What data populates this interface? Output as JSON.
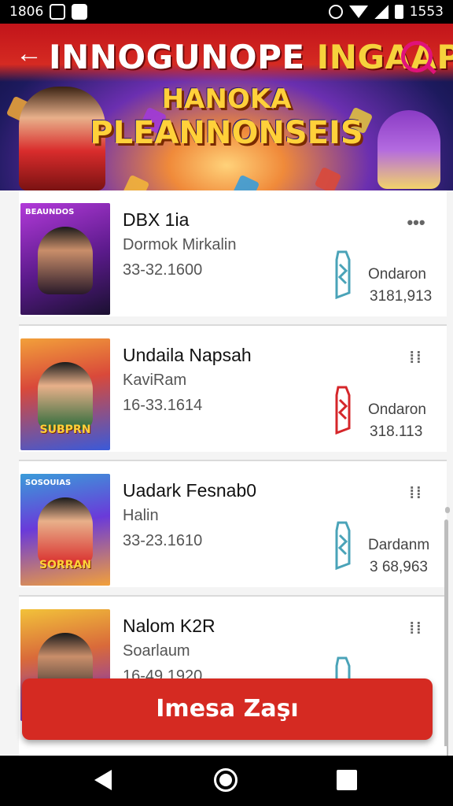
{
  "status_bar": {
    "time": "1806",
    "battery_text": "1553"
  },
  "banner": {
    "title_main": "INNOGUNOPE",
    "title_accent": "INGAAPO",
    "subtitle_line1": "HANOKA",
    "subtitle_line2": "PLEANNONSEIS"
  },
  "items": [
    {
      "name": "DBX 1ia",
      "author": "Dormok Mirkalin",
      "date": "33-32.1600",
      "badge_label": "Ondaron",
      "badge_value": "3181,913",
      "thumb_tag": "BEAUNDOS",
      "thumb_label": "",
      "badge_color": "#4aa3b8",
      "menu": "more-dots"
    },
    {
      "name": "Undaila Napsah",
      "author": "KaviRam",
      "date": "16-33.1614",
      "badge_label": "Ondaron",
      "badge_value": "318.113",
      "thumb_tag": "",
      "thumb_label": "SUBPRN",
      "badge_color": "#d5262a",
      "menu": "grid-dots"
    },
    {
      "name": "Uadark Fesnab0",
      "author": "Halin",
      "date": "33-23.1610",
      "badge_label": "Dardanm",
      "badge_value": "3 68,963",
      "thumb_tag": "SOSOUIAS",
      "thumb_label": "SORRAN",
      "badge_color": "#4aa3b8",
      "menu": "grid-dots"
    },
    {
      "name": "Nalom K2R",
      "author": "Soarlaum",
      "date": "16-49.1920",
      "badge_label": "",
      "badge_value": "",
      "thumb_tag": "",
      "thumb_label": "",
      "badge_color": "#4aa3b8",
      "menu": "grid-dots"
    }
  ],
  "cta": {
    "label": "Imesa Zaşı"
  },
  "colors": {
    "accent": "#d52a22",
    "badge_teal": "#4aa3b8",
    "badge_red": "#d5262a"
  },
  "icons": {
    "back": "back-arrow-icon",
    "search": "search-icon",
    "menu_more": "more-dots-icon",
    "menu_grid": "grid-dots-icon",
    "badge": "book-badge-icon"
  }
}
